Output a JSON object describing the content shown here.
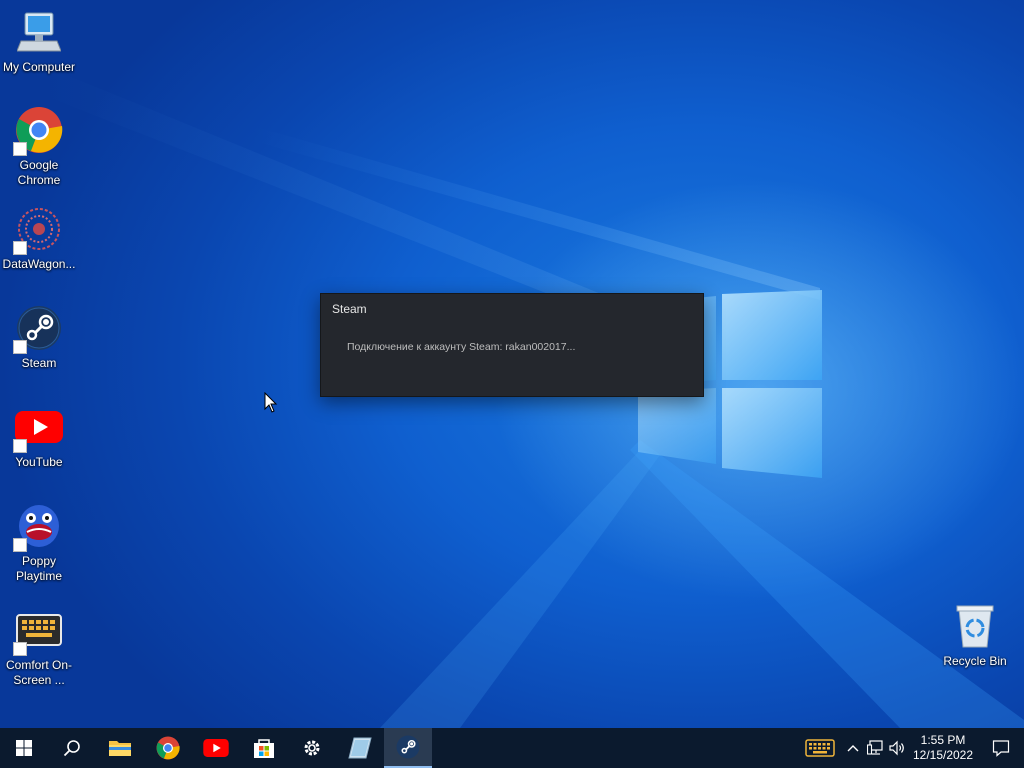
{
  "desktop": {
    "icons": [
      {
        "label": "My Computer",
        "icon": "computer-icon"
      },
      {
        "label": "Google Chrome",
        "icon": "chrome-icon"
      },
      {
        "label": "DataWagon...",
        "icon": "datawagon-icon"
      },
      {
        "label": "Steam",
        "icon": "steam-icon"
      },
      {
        "label": "YouTube",
        "icon": "youtube-icon"
      },
      {
        "label": "Poppy Playtime",
        "icon": "poppy-playtime-icon"
      },
      {
        "label": "Comfort On-Screen ...",
        "icon": "keyboard-icon"
      }
    ],
    "recycle_bin": {
      "label": "Recycle Bin",
      "icon": "recycle-bin-icon"
    }
  },
  "steam_dialog": {
    "title": "Steam",
    "message": "Подключение к аккаунту Steam: rakan002017..."
  },
  "taskbar": {
    "pinned": [
      "start-icon",
      "search-icon",
      "file-explorer-icon",
      "chrome-icon",
      "youtube-icon",
      "store-icon",
      "settings-icon",
      "notes-icon",
      "steam-icon"
    ],
    "active": "steam-icon",
    "clock": {
      "time": "1:55 PM",
      "date": "12/15/2022"
    }
  },
  "colors": {
    "wallpaper": "#0f5fcf",
    "taskbar": "#0b1a2e",
    "dialog": "#24272d",
    "accent": "#8fbdf0"
  }
}
